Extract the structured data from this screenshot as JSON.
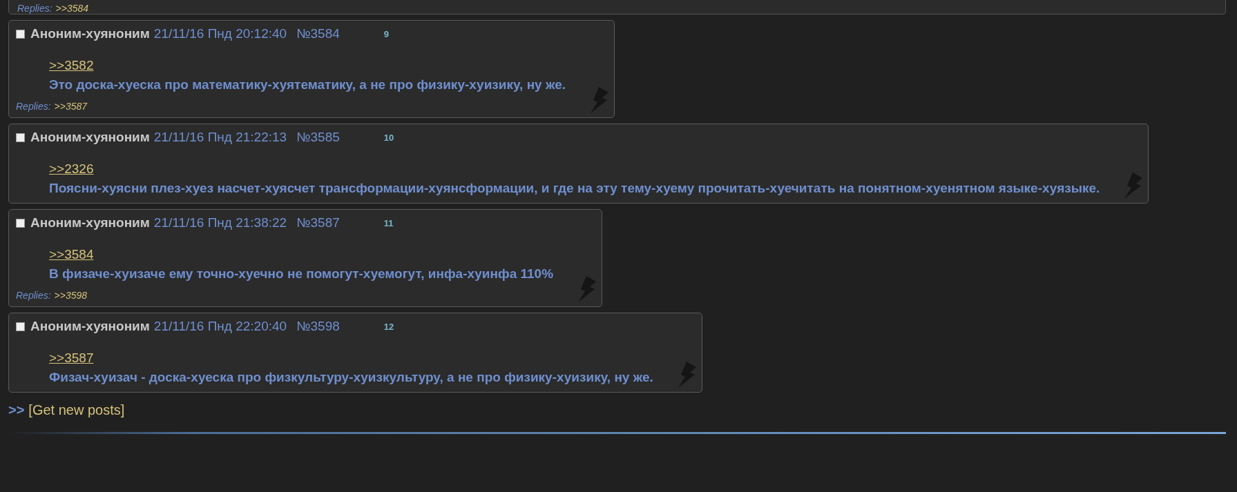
{
  "top_post": {
    "replies_label": "Replies:",
    "replies": [
      ">>3584"
    ]
  },
  "posts": [
    {
      "checked": false,
      "name": "Аноним-хуяноним",
      "date": "21/11/16 Пнд 20:12:40",
      "number": "№3584",
      "index": "9",
      "quote": ">>3582",
      "message": "Это доска-хуеска про математику-хуятематику, а не про физику-хуизику, ну же.",
      "replies_label": "Replies:",
      "replies": [
        ">>3587"
      ]
    },
    {
      "checked": false,
      "name": "Аноним-хуяноним",
      "date": "21/11/16 Пнд 21:22:13",
      "number": "№3585",
      "index": "10",
      "quote": ">>2326",
      "message": "Поясни-хуясни плез-хуез насчет-хуясчет трансформации-хуянсформации, и где на эту тему-хуему прочитать-хуечитать на понятном-хуенятном языке-хуязыке."
    },
    {
      "checked": false,
      "name": "Аноним-хуяноним",
      "date": "21/11/16 Пнд 21:38:22",
      "number": "№3587",
      "index": "11",
      "quote": ">>3584",
      "message": "В физаче-хуизаче ему точно-хуечно не помогут-хуемогут, инфа-хуинфа 110%",
      "replies_label": "Replies:",
      "replies": [
        ">>3598"
      ]
    },
    {
      "checked": false,
      "name": "Аноним-хуяноним",
      "date": "21/11/16 Пнд 22:20:40",
      "number": "№3598",
      "index": "12",
      "quote": ">>3587",
      "message": "Физач-хуизач - доска-хуеска про физкультуру-хуизкультуру, а не про физику-хуизику, ну же."
    }
  ],
  "footer": {
    "prefix": ">>",
    "link": "[Get new posts]"
  }
}
